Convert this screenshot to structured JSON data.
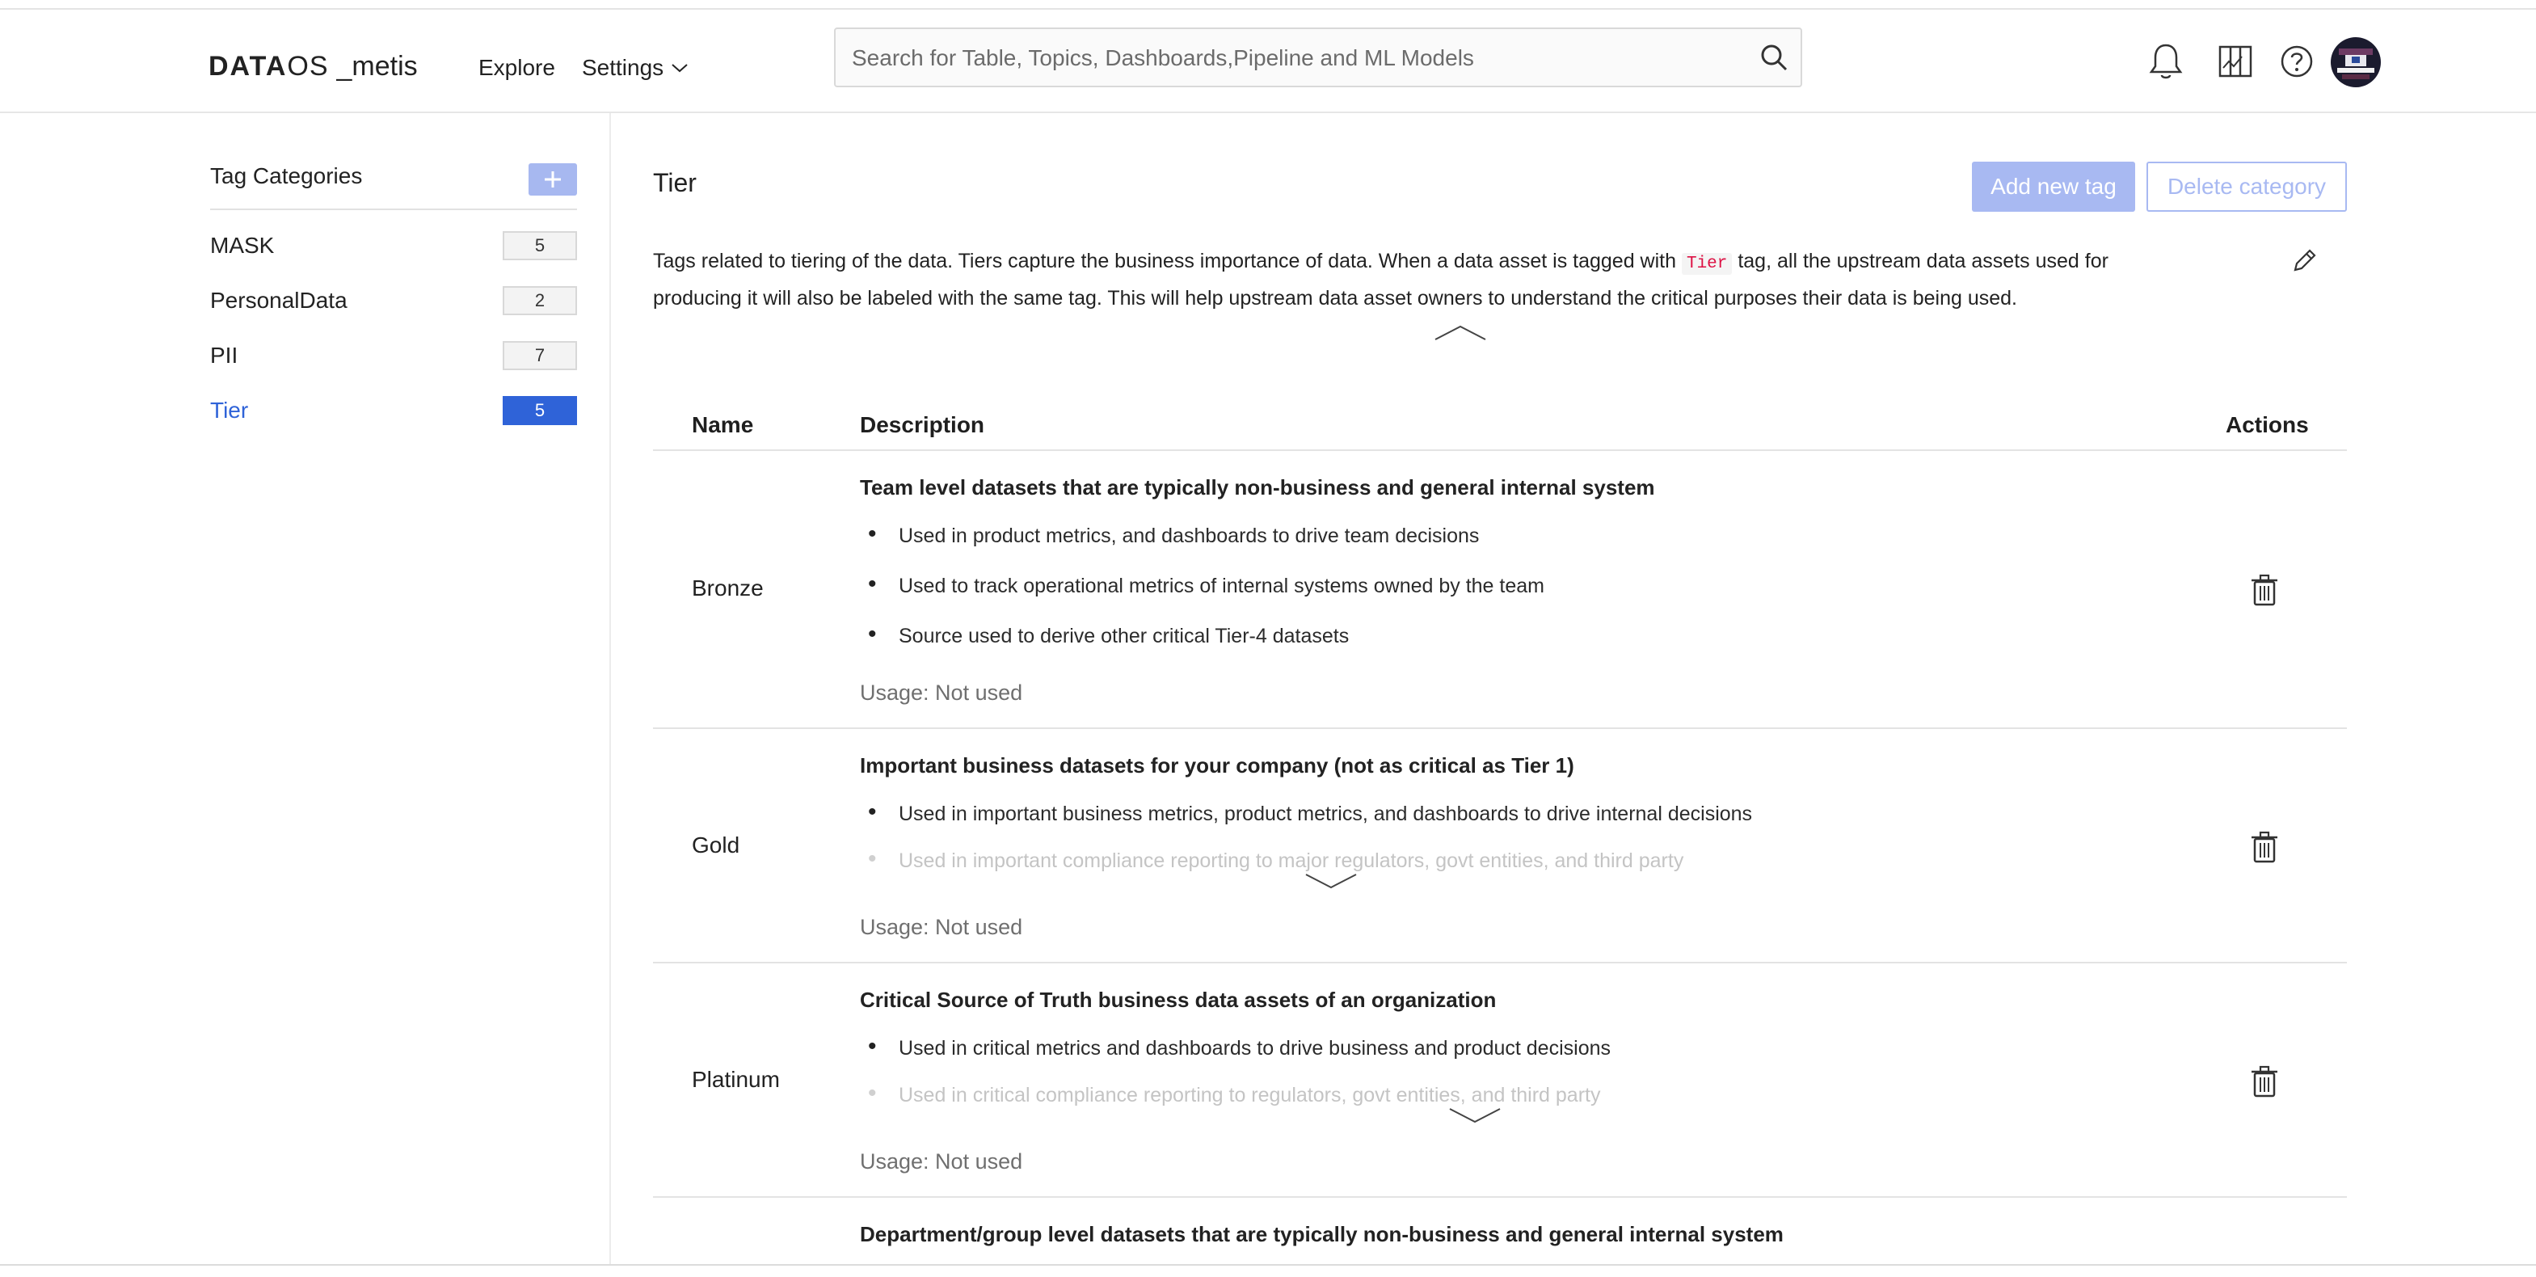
{
  "header": {
    "brand": "DATA",
    "brand_os": "OS",
    "brand_suffix": "_metis",
    "nav": {
      "explore": "Explore",
      "settings": "Settings"
    },
    "search": {
      "placeholder": "Search for Table, Topics, Dashboards,Pipeline and ML Models",
      "value": ""
    },
    "icons": [
      "bell-icon",
      "map-icon",
      "help-icon",
      "search-icon",
      "chevron-down-icon"
    ]
  },
  "sidebar": {
    "title": "Tag Categories",
    "add_label": "+",
    "items": [
      {
        "label": "MASK",
        "count": "5",
        "active": false
      },
      {
        "label": "PersonalData",
        "count": "2",
        "active": false
      },
      {
        "label": "PII",
        "count": "7",
        "active": false
      },
      {
        "label": "Tier",
        "count": "5",
        "active": true
      }
    ]
  },
  "main": {
    "title": "Tier",
    "add_tag_label": "Add new tag",
    "delete_category_label": "Delete category",
    "description": {
      "part1": "Tags related to tiering of the data. Tiers capture the business importance of data. When a data asset is tagged with ",
      "code": "Tier",
      "part2": " tag, all the upstream data assets used for",
      "line2": "producing it will also be labeled with the same tag. This will help upstream data asset owners to understand the critical purposes their data is being used."
    },
    "table": {
      "columns": [
        "Name",
        "Description",
        "Actions"
      ],
      "rows": [
        {
          "name": "Bronze",
          "title": "Team level datasets that are typically non-business and general internal system",
          "bullets": [
            "Used in product metrics, and dashboards to drive team decisions",
            "Used to track operational metrics of internal systems owned by the team",
            "Source used to derive other critical Tier-4 datasets"
          ],
          "usage": "Usage: Not used"
        },
        {
          "name": "Gold",
          "title": "Important business datasets for your company (not as critical as Tier 1)",
          "bullets": [
            "Used in important business metrics, product metrics, and dashboards to drive internal decisions",
            "Used in important compliance reporting to major regulators, govt entities, and third party"
          ],
          "usage": "Usage: Not used"
        },
        {
          "name": "Platinum",
          "title": "Critical Source of Truth business data assets of an organization",
          "bullets": [
            "Used in critical metrics and dashboards to drive business and product decisions",
            "Used in critical compliance reporting to regulators, govt entities, and third party"
          ],
          "usage": "Usage: Not used"
        },
        {
          "name": "",
          "title": "Department/group level datasets that are typically non-business and general internal system",
          "bullets": [],
          "usage": ""
        }
      ]
    }
  },
  "colors": {
    "accent": "#2f63d8",
    "accent_light": "#a8b9f2",
    "border": "#e3e3e3"
  }
}
